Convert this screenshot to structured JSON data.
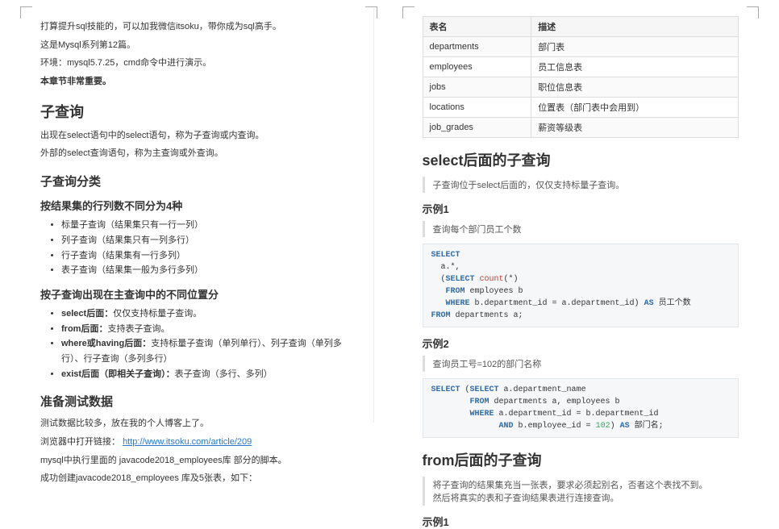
{
  "left": {
    "p1": "打算提升sql技能的，可以加我微信itsoku，带你成为sql高手。",
    "p2": "这是Mysql系列第12篇。",
    "p3": "环境：mysql5.7.25，cmd命令中进行演示。",
    "p4": "本章节非常重要。",
    "h2_sub": "子查询",
    "sub_p1": "出现在select语句中的select语句，称为子查询或内查询。",
    "sub_p2": "外部的select查询语句，称为主查询或外查询。",
    "h3_types": "子查询分类",
    "h4_byresult": "按结果集的行列数不同分为4种",
    "byresult_items": [
      "标量子查询（结果集只有一行一列）",
      "列子查询（结果集只有一列多行）",
      "行子查询（结果集有一行多列）",
      "表子查询（结果集一般为多行多列）"
    ],
    "h4_bypos": "按子查询出现在主查询中的不同位置分",
    "bypos_items": [
      {
        "b": "select后面：",
        "t": "仅仅支持标量子查询。"
      },
      {
        "b": "from后面：",
        "t": "支持表子查询。"
      },
      {
        "b": "where或having后面：",
        "t": "支持标量子查询（单列单行）、列子查询（单列多行）、行子查询（多列多行）"
      },
      {
        "b": "exist后面（即相关子查询）：",
        "t": "表子查询（多行、多列）"
      }
    ],
    "h3_testdata": "准备测试数据",
    "td_p1": "测试数据比较多，放在我的个人博客上了。",
    "td_p2_a": "浏览器中打开链接：",
    "td_link": "http://www.itsoku.com/article/209",
    "td_p3": "mysql中执行里面的 javacode2018_employees库 部分的脚本。",
    "td_p4": "成功创建javacode2018_employees 库及5张表，如下："
  },
  "right": {
    "table": {
      "headers": [
        "表名",
        "描述"
      ],
      "rows": [
        [
          "departments",
          "部门表"
        ],
        [
          "employees",
          "员工信息表"
        ],
        [
          "jobs",
          "职位信息表"
        ],
        [
          "locations",
          "位置表（部门表中会用到）"
        ],
        [
          "job_grades",
          "薪资等级表"
        ]
      ]
    },
    "h2_select": "select后面的子查询",
    "select_quote": "子查询位于select后面的，仅仅支持标量子查询。",
    "ex1": "示例1",
    "ex1_quote": "查询每个部门员工个数",
    "code1": {
      "l1a": "SELECT",
      "l2": "  a.*,",
      "l3a": "  (",
      "l3b": "SELECT",
      "l3c": " count",
      "l3d": "(*)",
      "l4a": "   FROM",
      "l4b": " employees b",
      "l5a": "   WHERE",
      "l5b": " b.department_id = a.department_id) ",
      "l5c": "AS",
      "l5d": " 员工个数",
      "l6a": "FROM",
      "l6b": " departments a;"
    },
    "ex2": "示例2",
    "ex2_quote": "查询员工号=102的部门名称",
    "code2": {
      "l1a": "SELECT",
      "l1b": " (",
      "l1c": "SELECT",
      "l1d": " a.department_name",
      "l2a": "        FROM",
      "l2b": " departments a, employees b",
      "l3a": "        WHERE",
      "l3b": " a.department_id = b.department_id",
      "l4a": "              AND",
      "l4b": " b.employee_id = ",
      "l4c": "102",
      "l4d": ") ",
      "l4e": "AS",
      "l4f": " 部门名;"
    },
    "h2_from": "from后面的子查询",
    "from_q1": "将子查询的结果集充当一张表，要求必须起别名，否者这个表找不到。",
    "from_q2": "然后将真实的表和子查询结果表进行连接查询。",
    "ex1b": "示例1"
  }
}
